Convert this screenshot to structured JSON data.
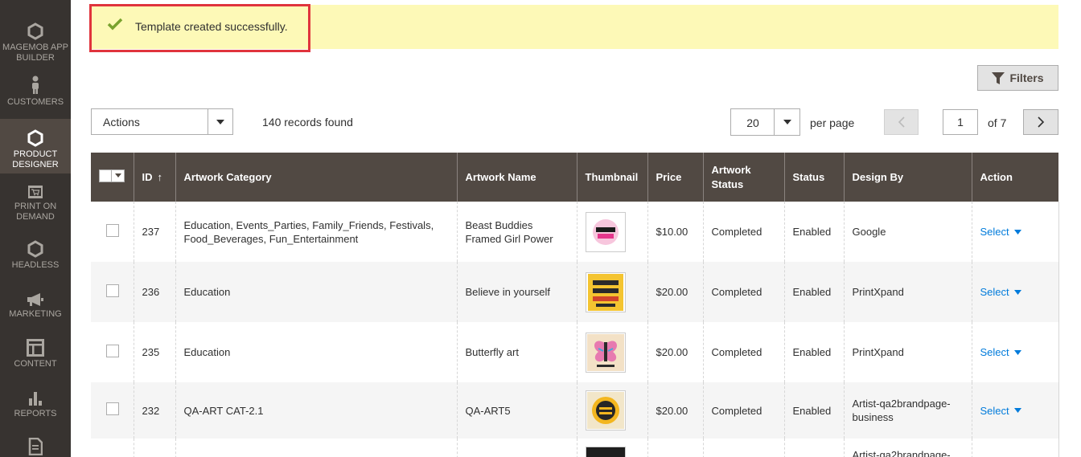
{
  "sidebar": {
    "items": [
      {
        "label": "MAGEMOB APP BUILDER",
        "icon": "hexagon-icon"
      },
      {
        "label": "CUSTOMERS",
        "icon": "person-icon"
      },
      {
        "label": "PRODUCT DESIGNER",
        "icon": "hexagon-icon",
        "active": true
      },
      {
        "label": "PRINT ON DEMAND",
        "icon": "cart-screen-icon"
      },
      {
        "label": "HEADLESS",
        "icon": "hexagon-icon"
      },
      {
        "label": "MARKETING",
        "icon": "megaphone-icon"
      },
      {
        "label": "CONTENT",
        "icon": "layout-icon"
      },
      {
        "label": "REPORTS",
        "icon": "bar-chart-icon"
      }
    ]
  },
  "message": {
    "text": "Template created successfully.",
    "type": "success"
  },
  "toolbar": {
    "filters_label": "Filters",
    "actions_label": "Actions",
    "records_found": "140 records found",
    "per_page_value": "20",
    "per_page_label": "per page",
    "current_page": "1",
    "of_pages": "of 7"
  },
  "grid": {
    "columns": [
      "ID",
      "Artwork Category",
      "Artwork Name",
      "Thumbnail",
      "Price",
      "Artwork Status",
      "Status",
      "Design By",
      "Action"
    ],
    "rows": [
      {
        "id": "237",
        "category": "Education, Events_Parties, Family_Friends, Festivals, Food_Beverages, Fun_Entertainment",
        "name": "Beast Buddies Framed Girl Power",
        "price": "$10.00",
        "artwork_status": "Completed",
        "status": "Enabled",
        "design_by": "Google",
        "action": "Select"
      },
      {
        "id": "236",
        "category": "Education",
        "name": "Believe in yourself",
        "price": "$20.00",
        "artwork_status": "Completed",
        "status": "Enabled",
        "design_by": "PrintXpand",
        "action": "Select"
      },
      {
        "id": "235",
        "category": "Education",
        "name": "Butterfly art",
        "price": "$20.00",
        "artwork_status": "Completed",
        "status": "Enabled",
        "design_by": "PrintXpand",
        "action": "Select"
      },
      {
        "id": "232",
        "category": "QA-ART CAT-2.1",
        "name": "QA-ART5",
        "price": "$20.00",
        "artwork_status": "Completed",
        "status": "Enabled",
        "design_by": "Artist-qa2brandpage-business",
        "action": "Select"
      },
      {
        "design_by": "Artist-qa2brandpage-"
      }
    ]
  },
  "colors": {
    "header_bg": "#514943",
    "sidebar_bg": "#373330",
    "link": "#007bdb",
    "message_bg": "#fdf9b7",
    "highlight_border": "#e0343d"
  }
}
